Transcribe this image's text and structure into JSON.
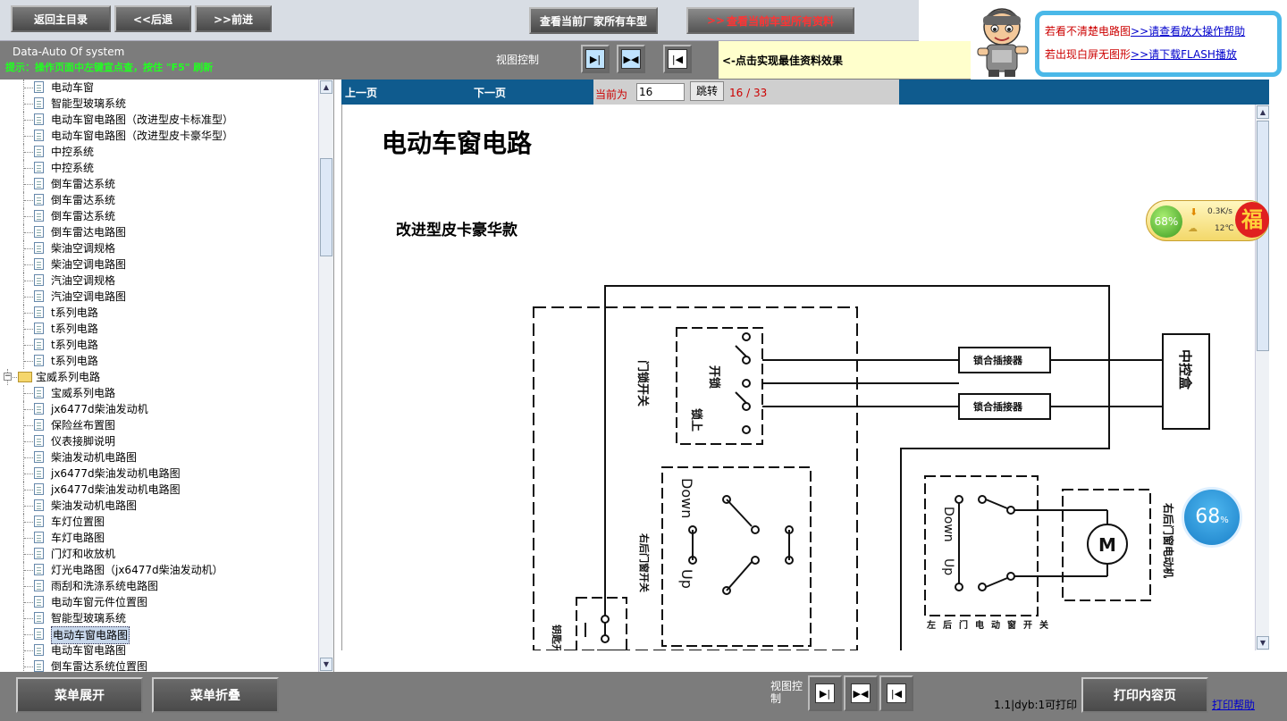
{
  "toolbar": {
    "home_label": "返回主目录",
    "back_label": "<<后退",
    "forward_label": ">>前进",
    "all_models_label": "查看当前厂家所有车型",
    "all_docs_label": "查看当前车型所有资料"
  },
  "help": {
    "line1_prefix": "若看不清楚电路图",
    "line1_link": ">>请查看放大操作帮助",
    "line2_prefix": "若出现白屏无图形",
    "line2_link": ">>请下载FLASH播放"
  },
  "system": {
    "title": "Data-Auto Of system",
    "tip": "提示：操作页面中左键宣点查，按住 \"F5\" 刷新"
  },
  "view_control": {
    "label": "视图控制",
    "tip": "<-点击实现最佳资料效果"
  },
  "tree": {
    "items": [
      {
        "label": "电动车窗",
        "type": "doc"
      },
      {
        "label": "智能型玻璃系统",
        "type": "doc"
      },
      {
        "label": "电动车窗电路图（改进型皮卡标准型）",
        "type": "doc"
      },
      {
        "label": "电动车窗电路图（改进型皮卡豪华型）",
        "type": "doc"
      },
      {
        "label": "中控系统",
        "type": "doc"
      },
      {
        "label": "中控系统",
        "type": "doc"
      },
      {
        "label": "倒车雷达系统",
        "type": "doc"
      },
      {
        "label": "倒车雷达系统",
        "type": "doc"
      },
      {
        "label": "倒车雷达系统",
        "type": "doc"
      },
      {
        "label": "倒车雷达电路图",
        "type": "doc"
      },
      {
        "label": "柴油空调规格",
        "type": "doc"
      },
      {
        "label": "柴油空调电路图",
        "type": "doc"
      },
      {
        "label": "汽油空调规格",
        "type": "doc"
      },
      {
        "label": "汽油空调电路图",
        "type": "doc"
      },
      {
        "label": "t系列电路",
        "type": "doc"
      },
      {
        "label": "t系列电路",
        "type": "doc"
      },
      {
        "label": "t系列电路",
        "type": "doc"
      },
      {
        "label": "t系列电路",
        "type": "doc"
      },
      {
        "label": "宝威系列电路",
        "type": "folder"
      },
      {
        "label": "宝威系列电路",
        "type": "doc"
      },
      {
        "label": "jx6477d柴油发动机",
        "type": "doc"
      },
      {
        "label": "保险丝布置图",
        "type": "doc"
      },
      {
        "label": "仪表接脚说明",
        "type": "doc"
      },
      {
        "label": "柴油发动机电路图",
        "type": "doc"
      },
      {
        "label": "jx6477d柴油发动机电路图",
        "type": "doc"
      },
      {
        "label": "jx6477d柴油发动机电路图",
        "type": "doc"
      },
      {
        "label": "柴油发动机电路图",
        "type": "doc"
      },
      {
        "label": "车灯位置图",
        "type": "doc"
      },
      {
        "label": "车灯电路图",
        "type": "doc"
      },
      {
        "label": "门灯和收放机",
        "type": "doc"
      },
      {
        "label": "灯光电路图（jx6477d柴油发动机）",
        "type": "doc"
      },
      {
        "label": "雨刮和洗涤系统电路图",
        "type": "doc"
      },
      {
        "label": "电动车窗元件位置图",
        "type": "doc"
      },
      {
        "label": "智能型玻璃系统",
        "type": "doc"
      },
      {
        "label": "电动车窗电路图",
        "type": "doc",
        "selected": true
      },
      {
        "label": "电动车窗电路图",
        "type": "doc"
      },
      {
        "label": "倒车雷达系统位置图",
        "type": "doc"
      }
    ]
  },
  "pager": {
    "prev_label": "上一页",
    "next_label": "下一页",
    "current_label": "当前为",
    "current_value": "16",
    "go_label": "跳转",
    "count": "16 / 33"
  },
  "document": {
    "title": "电动车窗电路",
    "subtitle": "改进型皮卡豪华款",
    "diagram_labels": {
      "door_lock_switch": "门锁开关",
      "open": "开锁",
      "lock": "锁上",
      "connector": "锁合插接器",
      "central_box": "中控盒",
      "right_rear_switch": "右后门窗开关",
      "down": "Down",
      "up": "Up",
      "motor": "M",
      "right_rear_motor": "右后门窗电动机",
      "key_switch": "钥匙开关",
      "left_rear_labels": "左后门电动窗开关"
    }
  },
  "widgets": {
    "net_percent": "68%",
    "net_speed": "0.3K/s",
    "net_temp": "12℃",
    "fu_char": "福",
    "circle_percent": "68",
    "circle_unit": "%"
  },
  "bottom": {
    "expand_label": "菜单展开",
    "collapse_label": "菜单折叠",
    "view_label": "视图控制",
    "print_label": "打印内容页",
    "status": "1.1|dyb:1可打印",
    "print_help": "打印帮助"
  }
}
